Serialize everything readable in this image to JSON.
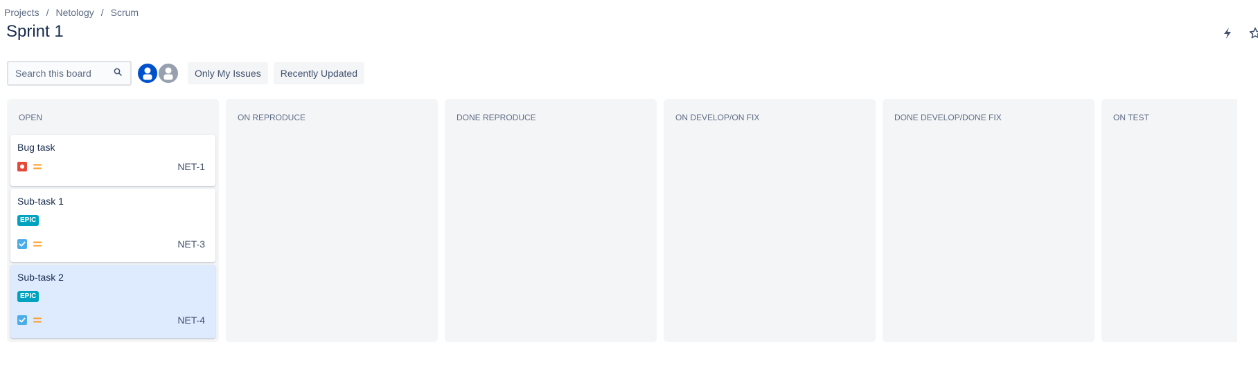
{
  "breadcrumb": {
    "items": [
      "Projects",
      "Netology",
      "Scrum"
    ],
    "separator": "/"
  },
  "page": {
    "title": "Sprint 1"
  },
  "header_actions": {
    "icons": [
      "lightning-icon",
      "star-icon"
    ]
  },
  "toolbar": {
    "search_placeholder": "Search this board",
    "avatars": [
      {
        "name": "user-avatar-1",
        "color": "#0052cc"
      },
      {
        "name": "user-avatar-2",
        "color": "#97a0af"
      }
    ],
    "filters": [
      "Only My Issues",
      "Recently Updated"
    ]
  },
  "board": {
    "columns": [
      {
        "title": "OPEN",
        "cards": [
          {
            "summary": "Bug task",
            "key": "NET-1",
            "type": "bug",
            "priority": "medium",
            "epic": ""
          },
          {
            "summary": "Sub-task 1",
            "key": "NET-3",
            "type": "subtask",
            "priority": "medium",
            "epic": "EPIC"
          },
          {
            "summary": "Sub-task 2",
            "key": "NET-4",
            "type": "subtask",
            "priority": "medium",
            "epic": "EPIC",
            "selected": true
          }
        ]
      },
      {
        "title": "ON REPRODUCE",
        "cards": []
      },
      {
        "title": "DONE REPRODUCE",
        "cards": []
      },
      {
        "title": "ON DEVELOP/ON FIX",
        "cards": []
      },
      {
        "title": "DONE DEVELOP/DONE FIX",
        "cards": []
      },
      {
        "title": "ON TEST",
        "cards": []
      }
    ]
  },
  "colors": {
    "bug": "#e5493a",
    "subtask": "#4bade8",
    "priority_medium": "#ff991f",
    "epic": "#00a3bf",
    "selected_card": "#deebff"
  }
}
